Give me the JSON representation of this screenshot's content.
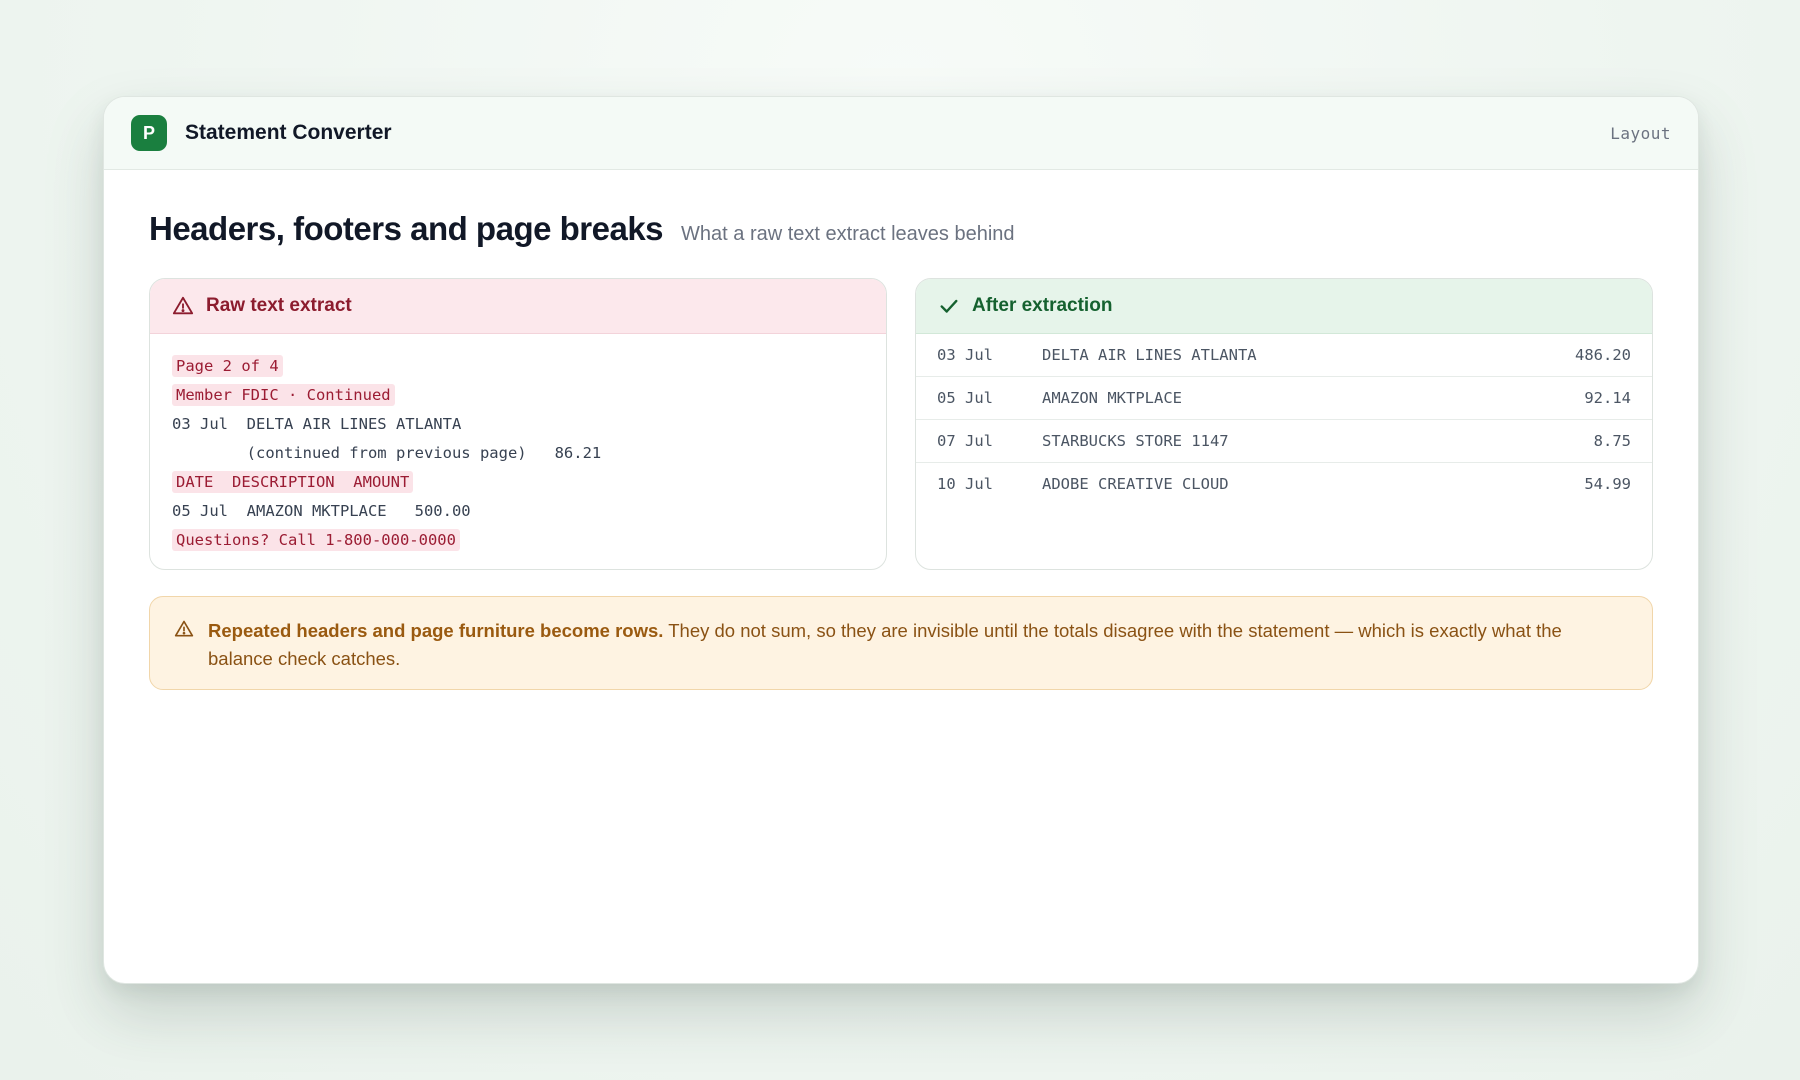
{
  "app": {
    "logo_letter": "P",
    "title": "Statement Converter",
    "layout_label": "Layout"
  },
  "page": {
    "heading": "Headers, footers and page breaks",
    "subheading": "What a raw text extract leaves behind"
  },
  "raw_panel": {
    "title": "Raw text extract",
    "icon": "warning-triangle-icon",
    "lines": [
      {
        "text": "Page 2 of 4",
        "flagged": true
      },
      {
        "text": "Member FDIC · Continued",
        "flagged": true
      },
      {
        "text": "03 Jul  DELTA AIR LINES ATLANTA",
        "flagged": false
      },
      {
        "text": "        (continued from previous page)   86.21",
        "flagged": false
      },
      {
        "text": "DATE  DESCRIPTION  AMOUNT",
        "flagged": true
      },
      {
        "text": "05 Jul  AMAZON MKTPLACE   500.00",
        "flagged": false
      },
      {
        "text": "Questions? Call 1-800-000-0000",
        "flagged": true
      }
    ]
  },
  "clean_panel": {
    "title": "After extraction",
    "icon": "check-icon",
    "rows": [
      {
        "date": "03 Jul",
        "description": "DELTA AIR LINES ATLANTA",
        "amount": "486.20"
      },
      {
        "date": "05 Jul",
        "description": "AMAZON MKTPLACE",
        "amount": "92.14"
      },
      {
        "date": "07 Jul",
        "description": "STARBUCKS STORE 1147",
        "amount": "8.75"
      },
      {
        "date": "10 Jul",
        "description": "ADOBE CREATIVE CLOUD",
        "amount": "54.99"
      }
    ]
  },
  "notice": {
    "icon": "warning-triangle-icon",
    "strong": "Repeated headers and page furniture become rows.",
    "text": " They do not sum, so they are invisible until the totals disagree with the statement — which is exactly what the balance check catches."
  },
  "colors": {
    "brand": "#1a7f3f",
    "bad": "#8c1c2e",
    "good": "#15612f",
    "warning": "#9a5a10"
  }
}
